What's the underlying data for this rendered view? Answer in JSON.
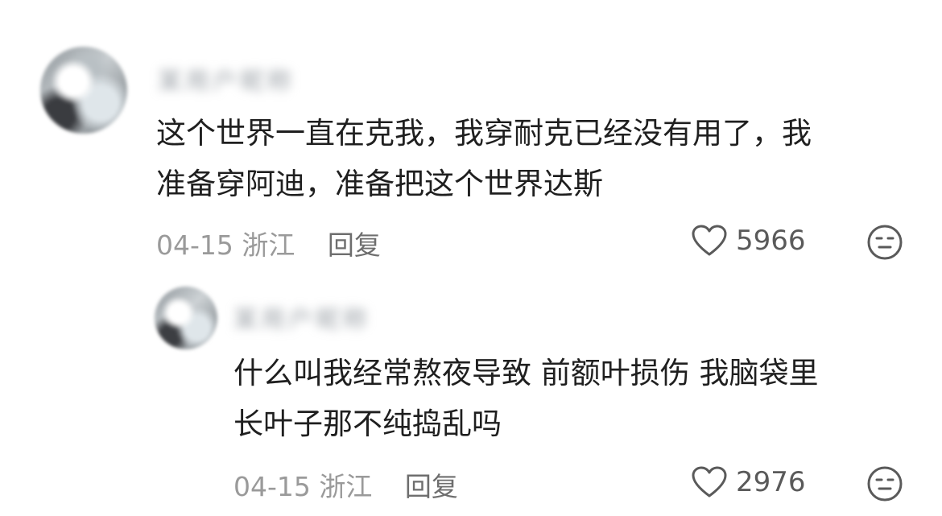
{
  "comments": {
    "main": {
      "username": "某用户昵称",
      "line1": "这个世界一直在克我，我穿耐克已经没有用了，我",
      "line2": "准备穿阿迪，准备把这个世界达斯",
      "date": "04-15",
      "location": "浙江",
      "reply_label": "回复",
      "likes": "5966",
      "icons": {
        "like": "heart-outline-icon",
        "reaction": "neutral-face-icon"
      }
    },
    "reply": {
      "username": "某用户昵称",
      "line1": "什么叫我经常熬夜导致 前额叶损伤 我脑袋里",
      "line2": "长叶子那不纯捣乱吗",
      "date": "04-15",
      "location": "浙江",
      "reply_label": "回复",
      "likes": "2976",
      "icons": {
        "like": "heart-outline-icon",
        "reaction": "neutral-face-icon"
      }
    }
  },
  "colors": {
    "text": "#1f1f1f",
    "meta": "#9a9a9a",
    "reply_label": "#6e6e6e",
    "icon": "#5a5a5a",
    "background": "#ffffff"
  }
}
